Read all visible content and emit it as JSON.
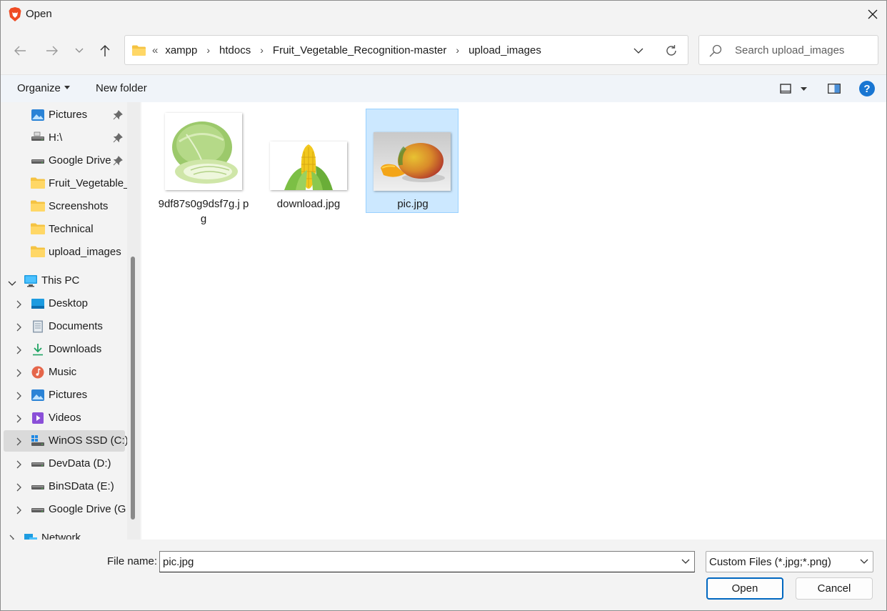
{
  "window": {
    "title": "Open",
    "app_icon": "brave-lion-icon"
  },
  "address_bar": {
    "overflow_glyph": "«",
    "crumbs": [
      "xampp",
      "htdocs",
      "Fruit_Vegetable_Recognition-master",
      "upload_images"
    ]
  },
  "search": {
    "placeholder": "Search upload_images"
  },
  "command_bar": {
    "organize_label": "Organize",
    "new_folder_label": "New folder",
    "help_label": "?"
  },
  "sidebar": {
    "quick_access": [
      {
        "label": "Pictures",
        "icon": "pictures-icon",
        "pinned": true
      },
      {
        "label": "H:\\",
        "icon": "drive-icon",
        "pinned": true
      },
      {
        "label": "Google Drive",
        "icon": "drive-icon",
        "pinned": true
      },
      {
        "label": "Fruit_Vegetable_",
        "icon": "folder-icon",
        "pinned": false
      },
      {
        "label": "Screenshots",
        "icon": "folder-icon",
        "pinned": false
      },
      {
        "label": "Technical",
        "icon": "folder-icon",
        "pinned": false
      },
      {
        "label": "upload_images",
        "icon": "folder-icon",
        "pinned": false
      }
    ],
    "this_pc_label": "This PC",
    "this_pc_items": [
      {
        "label": "Desktop",
        "icon": "desktop-icon"
      },
      {
        "label": "Documents",
        "icon": "documents-icon"
      },
      {
        "label": "Downloads",
        "icon": "downloads-icon"
      },
      {
        "label": "Music",
        "icon": "music-icon"
      },
      {
        "label": "Pictures",
        "icon": "pictures-icon"
      },
      {
        "label": "Videos",
        "icon": "videos-icon"
      },
      {
        "label": "WinOS SSD (C:)",
        "icon": "windows-drive-icon",
        "selected": true
      },
      {
        "label": "DevData (D:)",
        "icon": "drive-icon"
      },
      {
        "label": "BinSData (E:)",
        "icon": "drive-icon"
      },
      {
        "label": "Google Drive (G",
        "icon": "drive-icon"
      }
    ],
    "network_label": "Network"
  },
  "files": [
    {
      "name": "9df87s0g9dsf7g.jpg",
      "display_name": "9df87s0g9dsf7g.j pg",
      "thumb": "cabbage-thumbnail"
    },
    {
      "name": "download.jpg",
      "display_name": "download.jpg",
      "thumb": "corn-thumbnail"
    },
    {
      "name": "pic.jpg",
      "display_name": "pic.jpg",
      "thumb": "mango-thumbnail",
      "selected": true
    }
  ],
  "bottom": {
    "file_name_label": "File name:",
    "file_name_value": "pic.jpg",
    "file_type_value": "Custom Files (*.jpg;*.png)",
    "open_label": "Open",
    "cancel_label": "Cancel"
  },
  "colors": {
    "selection_bg": "#cce8ff",
    "selection_border": "#99d1ff",
    "accent": "#0067c0",
    "help_blue": "#1976d2"
  }
}
